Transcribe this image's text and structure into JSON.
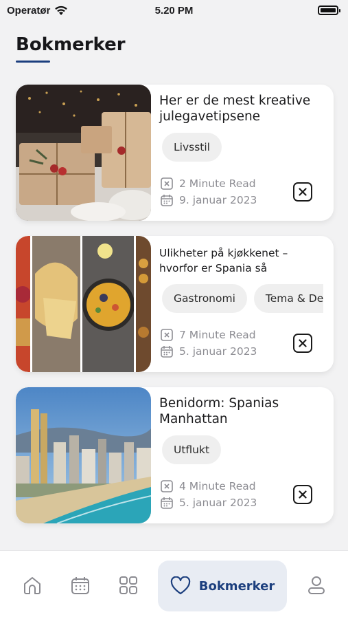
{
  "status_bar": {
    "carrier": "Operatør",
    "time": "5.20 PM"
  },
  "page": {
    "title": "Bokmerker"
  },
  "bookmarks": [
    {
      "title": "Her er de mest kreative julegavetipsene",
      "tags": [
        "Livsstil"
      ],
      "read_time": "2 Minute Read",
      "date": "9. januar 2023",
      "image": "wrapped-gifts-photo"
    },
    {
      "title": "Ulikheter på kjøkkenet – hvorfor er Spania så",
      "tags": [
        "Gastronomi",
        "Tema & De"
      ],
      "read_time": "7 Minute Read",
      "date": "5. januar 2023",
      "image": "spanish-food-collage"
    },
    {
      "title": "Benidorm: Spanias Manhattan",
      "tags": [
        "Utflukt"
      ],
      "read_time": "4 Minute Read",
      "date": "5. januar 2023",
      "image": "benidorm-skyline-photo"
    }
  ],
  "nav": {
    "items": [
      "home-icon",
      "calendar-icon",
      "grid-icon",
      "heart-icon",
      "profile-icon"
    ],
    "active_label": "Bokmerker"
  },
  "colors": {
    "accent": "#1c3f7e",
    "active_bg": "#e8ecf3",
    "muted_text": "#8d8d93"
  }
}
